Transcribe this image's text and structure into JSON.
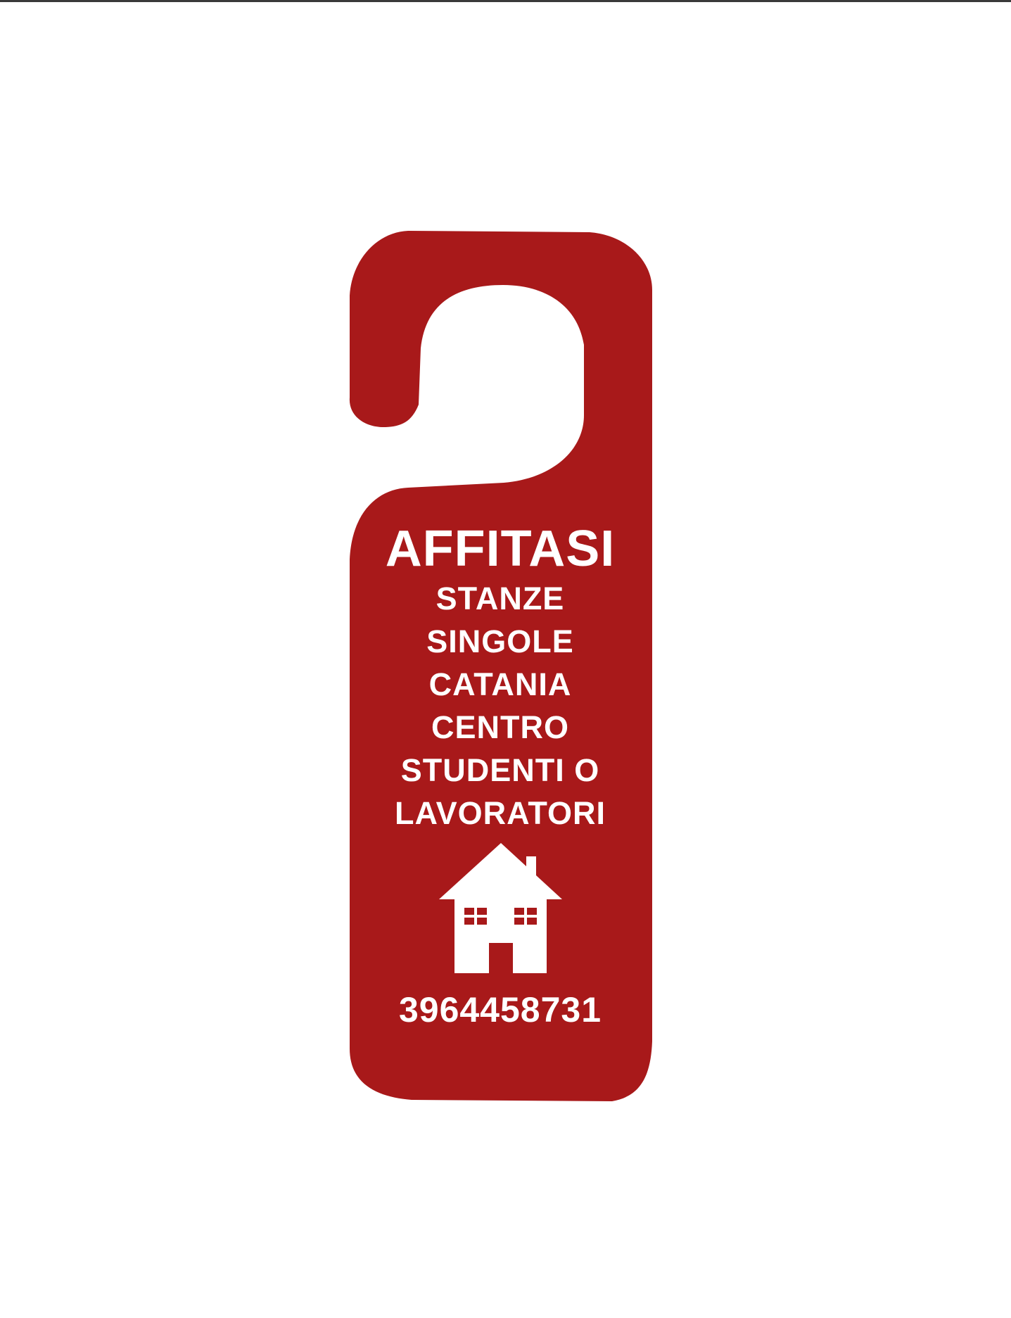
{
  "colors": {
    "hanger": "#a8191a",
    "text": "#ffffff",
    "background": "#ffffff"
  },
  "sign": {
    "headline": "AFFITASI",
    "lines": [
      "STANZE",
      "SINGOLE",
      "CATANIA",
      "CENTRO",
      "STUDENTI O",
      "LAVORATORI"
    ],
    "icon": "house-icon",
    "phone": "3964458731"
  }
}
